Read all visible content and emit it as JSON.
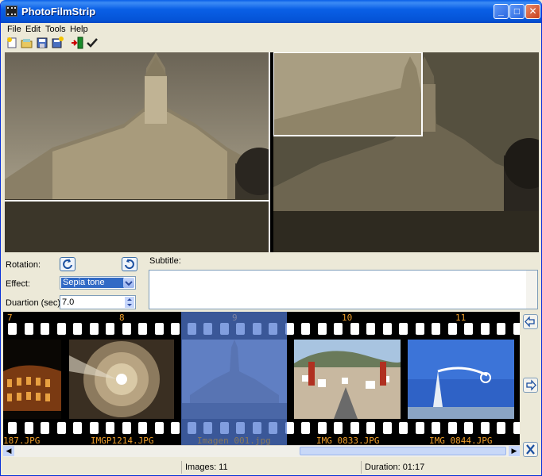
{
  "window": {
    "title": "PhotoFilmStrip"
  },
  "menu": [
    "File",
    "Edit",
    "Tools",
    "Help"
  ],
  "toolbar_icons": [
    "new-project-icon",
    "open-project-icon",
    "save-project-icon",
    "save-as-icon",
    "import-pictures-icon",
    "render-check-icon"
  ],
  "controls": {
    "rotation_label": "Rotation:",
    "effect_label": "Effect:",
    "effect_value": "Sepia tone",
    "duration_label": "Duartion (sec):",
    "duration_value": "7.0",
    "subtitle_label": "Subtitle:",
    "subtitle_value": ""
  },
  "filmstrip": {
    "frames": [
      {
        "number": "7",
        "name": "187.JPG"
      },
      {
        "number": "8",
        "name": "IMGP1214.JPG"
      },
      {
        "number": "9",
        "name": "Imagen 001.jpg"
      },
      {
        "number": "10",
        "name": "IMG_0833.JPG"
      },
      {
        "number": "11",
        "name": "IMG_0844.JPG"
      }
    ],
    "selected_index": 2
  },
  "status": {
    "images": "Images: 11",
    "duration": "Duration: 01:17"
  }
}
